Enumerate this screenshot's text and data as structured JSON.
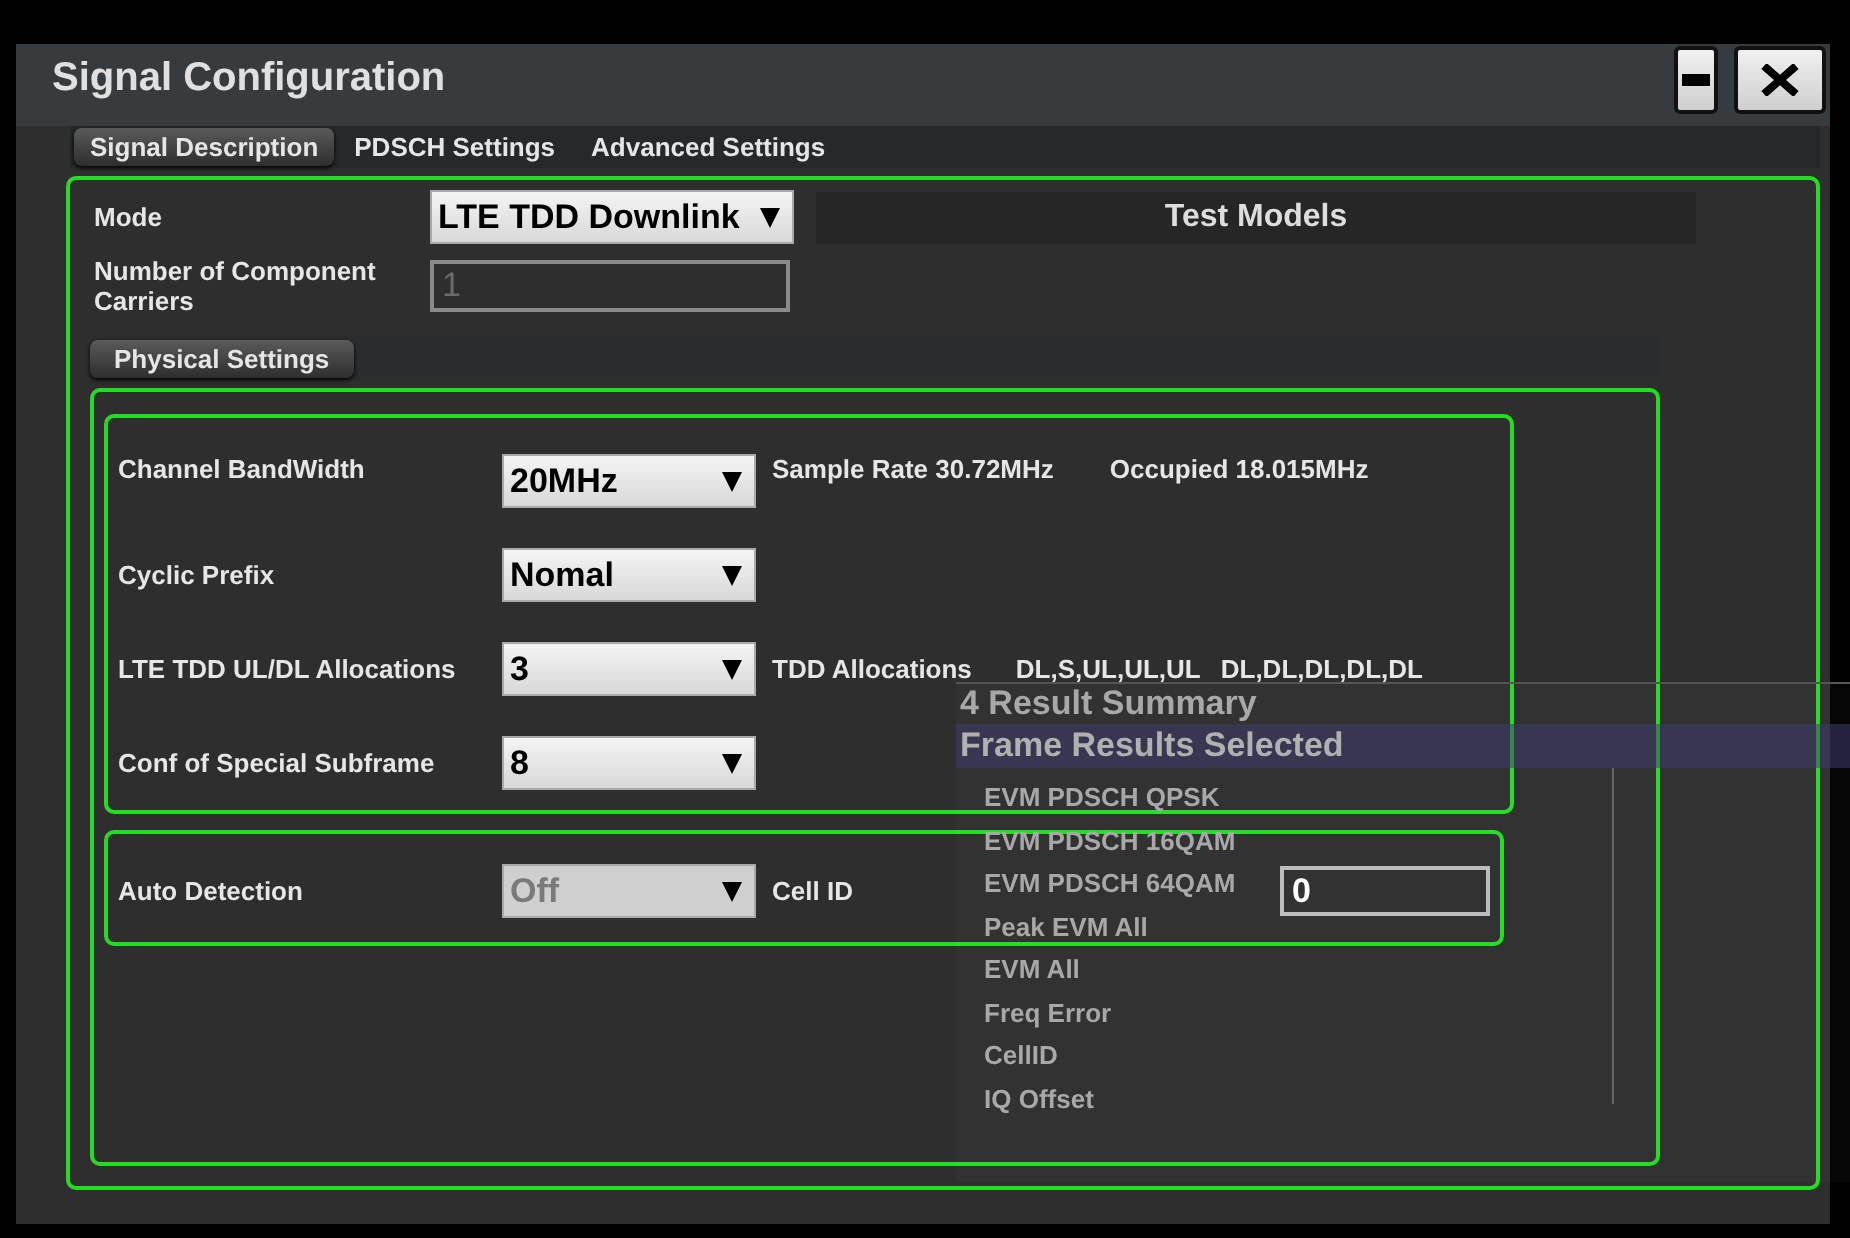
{
  "background_results": {
    "title": "4 Result Summary",
    "header": "Frame Results Selected",
    "items": [
      "EVM PDSCH QPSK",
      "EVM PDSCH 16QAM",
      "EVM PDSCH 64QAM",
      "Peak EVM All",
      "EVM All",
      "Freq Error",
      "CellID",
      "IQ Offset"
    ]
  },
  "window": {
    "title": "Signal Configuration"
  },
  "window_buttons": [
    {
      "kind": "minimize"
    },
    {
      "kind": "close"
    }
  ],
  "tabs": [
    {
      "label": "Signal Description",
      "selected": true
    },
    {
      "label": "PDSCH Settings",
      "selected": false
    },
    {
      "label": "Advanced Settings",
      "selected": false
    }
  ],
  "mode": {
    "label": "Mode",
    "value": "LTE TDD Downlink",
    "disabled": false
  },
  "test_models": {
    "title": "Test Models"
  },
  "component_carriers": {
    "label": "Number of Component Carriers",
    "value": "1",
    "disabled": true
  },
  "section_tab": {
    "label": "Physical Settings"
  },
  "physical_settings": [
    {
      "label": "Channel BandWidth",
      "value": "20MHz",
      "disabled": false,
      "info": [
        "Sample Rate 30.72MHz",
        "Occupied 18.015MHz"
      ]
    },
    {
      "label": "Cyclic Prefix",
      "value": "Nomal",
      "disabled": false
    },
    {
      "label": "LTE TDD UL/DL Allocations",
      "value": "3",
      "disabled": false,
      "info": [
        "TDD Allocations",
        "DL,S,UL,UL,UL",
        "DL,DL,DL,DL,DL"
      ]
    },
    {
      "label": "Conf of Special Subframe",
      "value": "8",
      "disabled": false
    }
  ],
  "detection": {
    "label": "Auto Detection",
    "value": "Off",
    "disabled": true
  },
  "cell_id": {
    "label": "Cell ID",
    "value": "0"
  }
}
